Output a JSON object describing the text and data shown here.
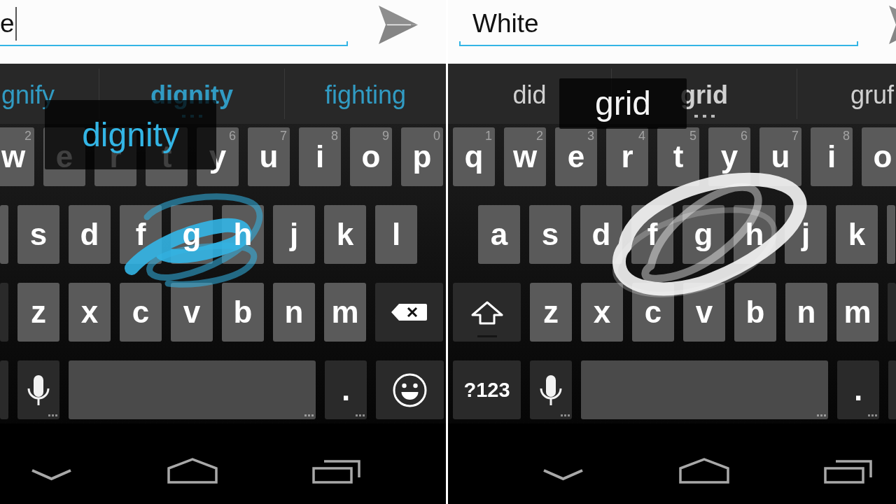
{
  "panels": [
    {
      "color": "#33b5e5",
      "text_field": {
        "value": "e",
        "caret": true
      },
      "suggestions": [
        {
          "text": "gnify",
          "selected": false
        },
        {
          "text": "dignity",
          "selected": true
        },
        {
          "text": "fighting",
          "selected": false
        }
      ],
      "preview": "dignity",
      "keyboard": {
        "rows": [
          {
            "keys": [
              {
                "kind": "letter",
                "label": "w",
                "hint": "2"
              },
              {
                "kind": "letter",
                "label": "e"
              },
              {
                "kind": "letter",
                "label": "r"
              },
              {
                "kind": "letter",
                "label": "t"
              },
              {
                "kind": "letter",
                "label": "y",
                "hint": "6"
              },
              {
                "kind": "letter",
                "label": "u",
                "hint": "7"
              },
              {
                "kind": "letter",
                "label": "i",
                "hint": "8"
              },
              {
                "kind": "letter",
                "label": "o",
                "hint": "9"
              },
              {
                "kind": "letter",
                "label": "p",
                "hint": "0"
              }
            ]
          },
          {
            "keys": [
              {
                "kind": "stub"
              },
              {
                "kind": "letter",
                "label": "s"
              },
              {
                "kind": "letter",
                "label": "d"
              },
              {
                "kind": "letter",
                "label": "f"
              },
              {
                "kind": "letter",
                "label": "g"
              },
              {
                "kind": "letter",
                "label": "h"
              },
              {
                "kind": "letter",
                "label": "j"
              },
              {
                "kind": "letter",
                "label": "k"
              },
              {
                "kind": "letter",
                "label": "l"
              }
            ]
          },
          {
            "keys": [
              {
                "kind": "darkstub"
              },
              {
                "kind": "letter",
                "label": "z"
              },
              {
                "kind": "letter",
                "label": "x"
              },
              {
                "kind": "letter",
                "label": "c"
              },
              {
                "kind": "letter",
                "label": "v"
              },
              {
                "kind": "letter",
                "label": "b"
              },
              {
                "kind": "letter",
                "label": "n"
              },
              {
                "kind": "letter",
                "label": "m"
              },
              {
                "kind": "delete"
              }
            ]
          },
          {
            "keys": [
              {
                "kind": "darkstub"
              },
              {
                "kind": "mic"
              },
              {
                "kind": "space"
              },
              {
                "kind": "period",
                "label": "."
              },
              {
                "kind": "emoji"
              }
            ]
          }
        ]
      },
      "nav_bar": [
        {
          "kind": "back"
        },
        {
          "kind": "home"
        },
        {
          "kind": "recents"
        }
      ]
    },
    {
      "color": "#f5f5f5",
      "text_field": {
        "value": "White",
        "caret": false
      },
      "suggestions": [
        {
          "text": "did",
          "selected": false
        },
        {
          "text": "grid",
          "selected": true
        },
        {
          "text": "gruf",
          "selected": false
        }
      ],
      "preview": "grid",
      "keyboard": {
        "rows": [
          {
            "keys": [
              {
                "kind": "letter",
                "label": "q",
                "hint": "1"
              },
              {
                "kind": "letter",
                "label": "w",
                "hint": "2"
              },
              {
                "kind": "letter",
                "label": "e",
                "hint": "3"
              },
              {
                "kind": "letter",
                "label": "r",
                "hint": "4"
              },
              {
                "kind": "letter",
                "label": "t",
                "hint": "5"
              },
              {
                "kind": "letter",
                "label": "y",
                "hint": "6"
              },
              {
                "kind": "letter",
                "label": "u",
                "hint": "7"
              },
              {
                "kind": "letter",
                "label": "i",
                "hint": "8"
              },
              {
                "kind": "letter",
                "label": "o"
              }
            ]
          },
          {
            "keys": [
              {
                "kind": "letter",
                "label": "a"
              },
              {
                "kind": "letter",
                "label": "s"
              },
              {
                "kind": "letter",
                "label": "d"
              },
              {
                "kind": "letter",
                "label": "f"
              },
              {
                "kind": "letter",
                "label": "g"
              },
              {
                "kind": "letter",
                "label": "h"
              },
              {
                "kind": "letter",
                "label": "j"
              },
              {
                "kind": "letter",
                "label": "k"
              },
              {
                "kind": "stub"
              }
            ]
          },
          {
            "keys": [
              {
                "kind": "shift",
                "locked": false
              },
              {
                "kind": "letter",
                "label": "z"
              },
              {
                "kind": "letter",
                "label": "x"
              },
              {
                "kind": "letter",
                "label": "c"
              },
              {
                "kind": "letter",
                "label": "v"
              },
              {
                "kind": "letter",
                "label": "b"
              },
              {
                "kind": "letter",
                "label": "n"
              },
              {
                "kind": "letter",
                "label": "m"
              },
              {
                "kind": "darkstub"
              }
            ]
          },
          {
            "keys": [
              {
                "kind": "symbols",
                "label": "?123"
              },
              {
                "kind": "mic"
              },
              {
                "kind": "space"
              },
              {
                "kind": "period",
                "label": "."
              },
              {
                "kind": "darkstub"
              }
            ]
          }
        ]
      },
      "nav_bar": [
        {
          "kind": "back"
        },
        {
          "kind": "home"
        },
        {
          "kind": "recents"
        }
      ]
    }
  ]
}
